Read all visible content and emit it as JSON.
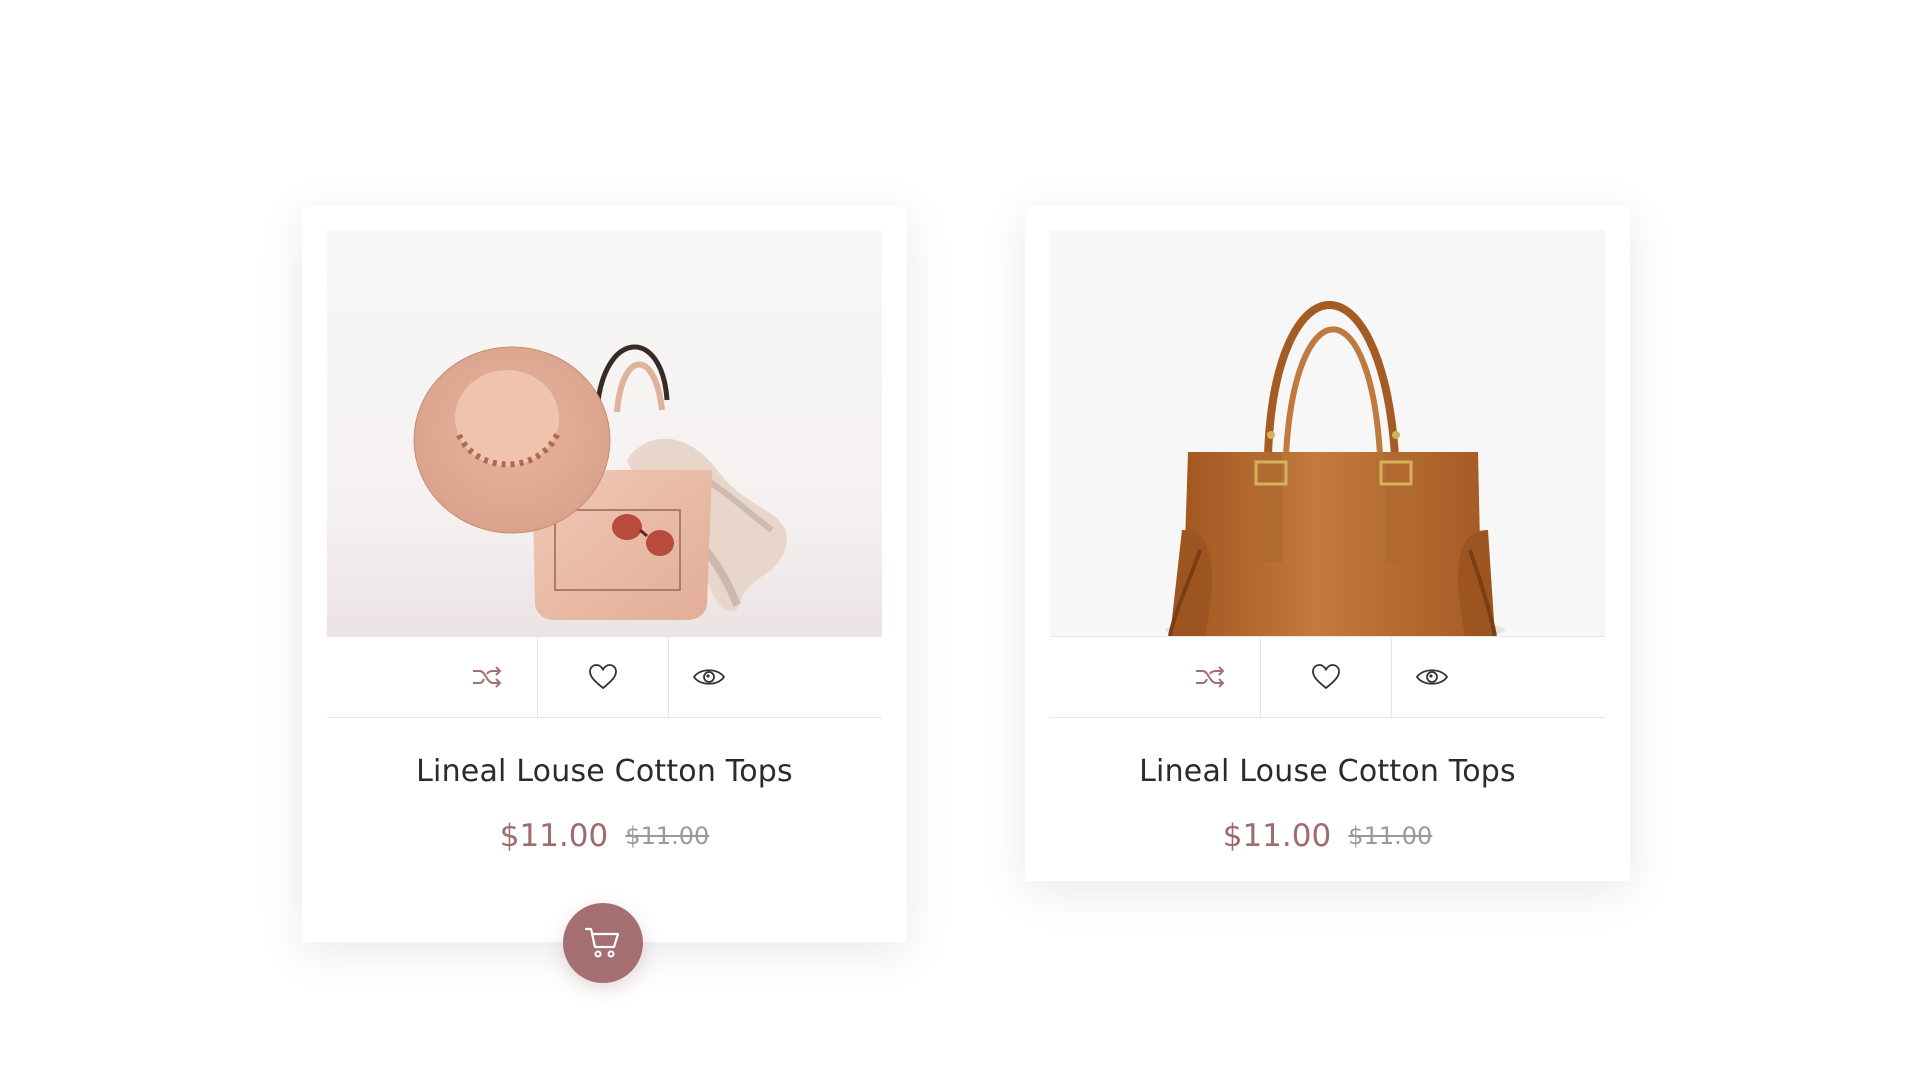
{
  "products": [
    {
      "title": "Lineal Louse Cotton Tops",
      "price": "$11.00",
      "old_price": "$11.00",
      "image": "hat-bag-scarf-sunglasses"
    },
    {
      "title": "Lineal Louse Cotton Tops",
      "price": "$11.00",
      "old_price": "$11.00",
      "image": "brown-leather-tote-bag"
    }
  ],
  "icons": {
    "compare": "shuffle-icon",
    "wishlist": "heart-icon",
    "quick_view": "eye-icon",
    "cart": "cart-icon"
  },
  "colors": {
    "accent": "#a56f71",
    "price": "#a06a6e",
    "old_price": "#9a9a9a",
    "title": "#2b2b2b"
  }
}
